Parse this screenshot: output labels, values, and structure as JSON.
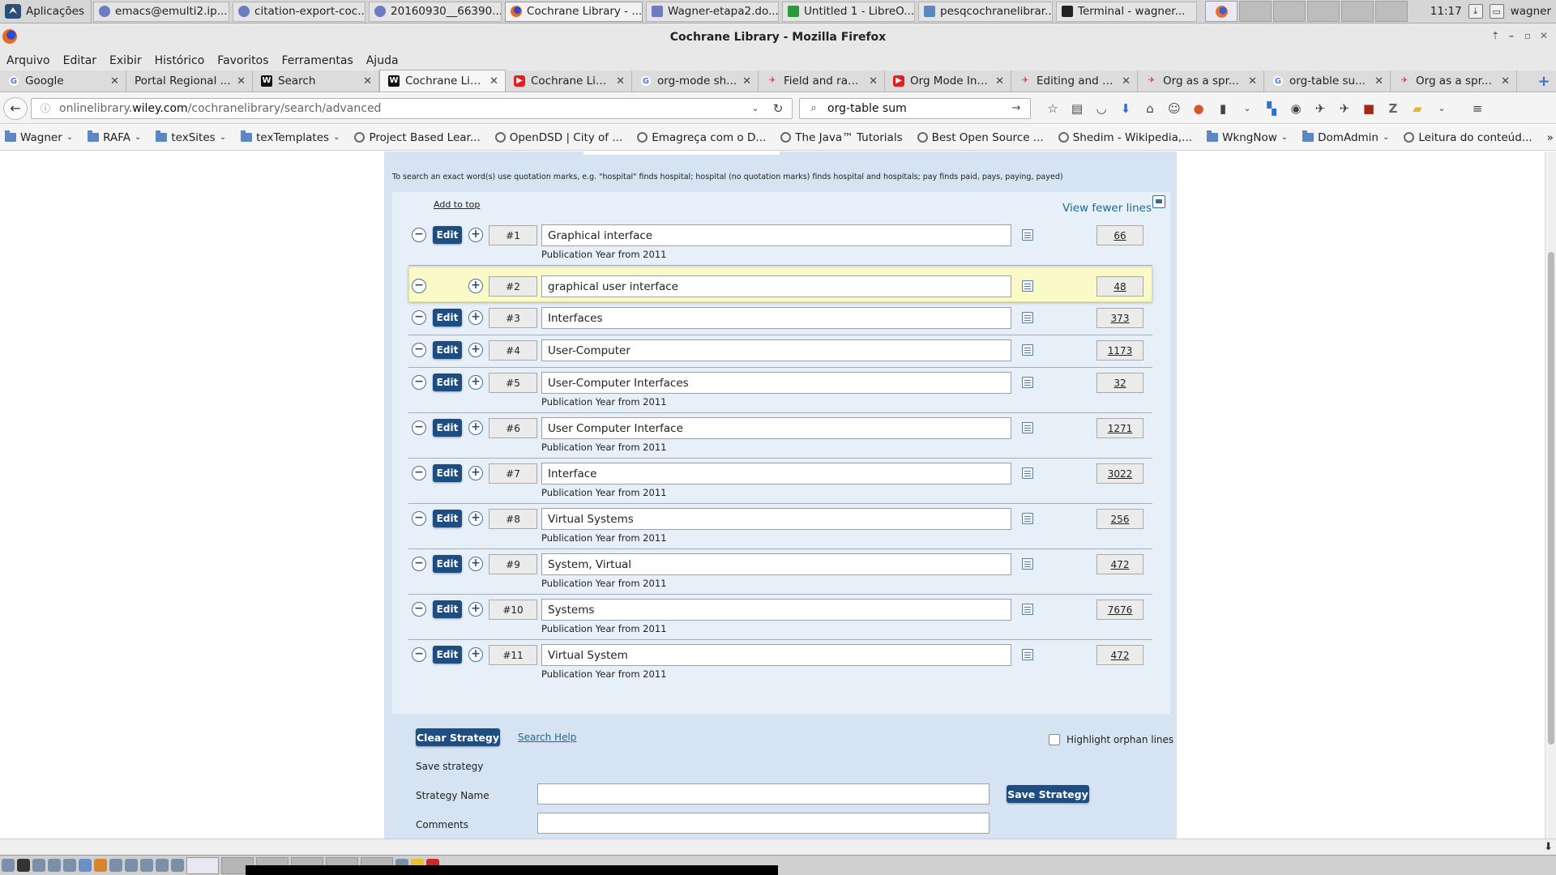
{
  "os_bar": {
    "apps_label": "Aplicações",
    "tasks": [
      {
        "label": "emacs@emulti2.ip...",
        "icon": "emacs-icon"
      },
      {
        "label": "citation-export-coc...",
        "icon": "emacs-icon"
      },
      {
        "label": "20160930__66390...",
        "icon": "emacs-icon"
      },
      {
        "label": "Cochrane Library - ...",
        "icon": "firefox-icon"
      },
      {
        "label": "Wagner-etapa2.do...",
        "icon": "document-icon"
      },
      {
        "label": "Untitled 1 - LibreO...",
        "icon": "spreadsheet-icon"
      },
      {
        "label": "pesqcochranelibrar...",
        "icon": "folder-icon"
      },
      {
        "label": "Terminal - wagner...",
        "icon": "terminal-icon"
      }
    ],
    "clock": "11:17",
    "user": "wagner"
  },
  "window": {
    "title": "Cochrane Library - Mozilla Firefox"
  },
  "menu": [
    "Arquivo",
    "Editar",
    "Exibir",
    "Histórico",
    "Favoritos",
    "Ferramentas",
    "Ajuda"
  ],
  "tabs": [
    {
      "label": "Google",
      "icon": "google-icon"
    },
    {
      "label": "Portal Regional ...",
      "icon": "none"
    },
    {
      "label": "Search",
      "icon": "wiley-icon"
    },
    {
      "label": "Cochrane Lib...",
      "icon": "wiley-icon"
    },
    {
      "label": "Cochrane Lib...",
      "icon": "youtube-icon"
    },
    {
      "label": "org-mode sh...",
      "icon": "google-icon"
    },
    {
      "label": "Field and ran...",
      "icon": "bird-icon"
    },
    {
      "label": "Org Mode In ...",
      "icon": "youtube-icon"
    },
    {
      "label": "Editing and d...",
      "icon": "bird-icon"
    },
    {
      "label": "Org as a spr...",
      "icon": "bird-icon"
    },
    {
      "label": "org-table su...",
      "icon": "google-icon"
    },
    {
      "label": "Org as a spr...",
      "icon": "bird-icon"
    }
  ],
  "nav": {
    "url_prefix": "onlinelibrary.",
    "url_domain": "wiley.com",
    "url_path": "/cochranelibrary/search/advanced",
    "search_value": "org-table sum"
  },
  "bookmarks": [
    {
      "label": "Wagner",
      "type": "folder"
    },
    {
      "label": "RAFA",
      "type": "folder"
    },
    {
      "label": "texSites",
      "type": "folder"
    },
    {
      "label": "texTemplates",
      "type": "folder"
    },
    {
      "label": "Project Based Lear...",
      "type": "link"
    },
    {
      "label": "OpenDSD | City of ...",
      "type": "link"
    },
    {
      "label": "Emagreça com o D...",
      "type": "link"
    },
    {
      "label": "The Java™ Tutorials",
      "type": "link"
    },
    {
      "label": "Best Open Source ...",
      "type": "link"
    },
    {
      "label": "Shedim - Wikipedia,...",
      "type": "link"
    },
    {
      "label": "WkngNow",
      "type": "folder"
    },
    {
      "label": "DomAdmin",
      "type": "folder"
    },
    {
      "label": "Leitura do conteúd...",
      "type": "link"
    }
  ],
  "search_manager": {
    "hint": "To search an exact word(s) use quotation marks, e.g. \"hospital\" finds hospital; hospital (no quotation marks) finds hospital and hospitals; pay finds paid, pays, paying, payed)",
    "add_to_top": "Add to top",
    "view_fewer": "View fewer lines",
    "edit_label": "Edit",
    "limit_text": "Publication Year from 2011",
    "rows": [
      {
        "num": "#1",
        "term": "Graphical interface",
        "count": "66",
        "limit": true,
        "selected": false
      },
      {
        "num": "#2",
        "term": "graphical user interface",
        "count": "48",
        "limit": false,
        "selected": true
      },
      {
        "num": "#3",
        "term": "Interfaces",
        "count": "373",
        "limit": false,
        "selected": false
      },
      {
        "num": "#4",
        "term": "User-Computer",
        "count": "1173",
        "limit": false,
        "selected": false
      },
      {
        "num": "#5",
        "term": "User-Computer Interfaces",
        "count": "32",
        "limit": true,
        "selected": false
      },
      {
        "num": "#6",
        "term": "User Computer Interface",
        "count": "1271",
        "limit": true,
        "selected": false
      },
      {
        "num": "#7",
        "term": "Interface",
        "count": "3022",
        "limit": true,
        "selected": false
      },
      {
        "num": "#8",
        "term": "Virtual Systems",
        "count": "256",
        "limit": true,
        "selected": false
      },
      {
        "num": "#9",
        "term": "System, Virtual",
        "count": "472",
        "limit": true,
        "selected": false
      },
      {
        "num": "#10",
        "term": "Systems",
        "count": "7676",
        "limit": true,
        "selected": false
      },
      {
        "num": "#11",
        "term": "Virtual System",
        "count": "472",
        "limit": true,
        "selected": false
      }
    ],
    "clear_strategy": "Clear Strategy",
    "search_help": "Search Help",
    "highlight_orphan": "Highlight orphan lines",
    "save_heading": "Save strategy",
    "strategy_name_label": "Strategy Name",
    "comments_label": "Comments",
    "save_button": "Save Strategy"
  }
}
